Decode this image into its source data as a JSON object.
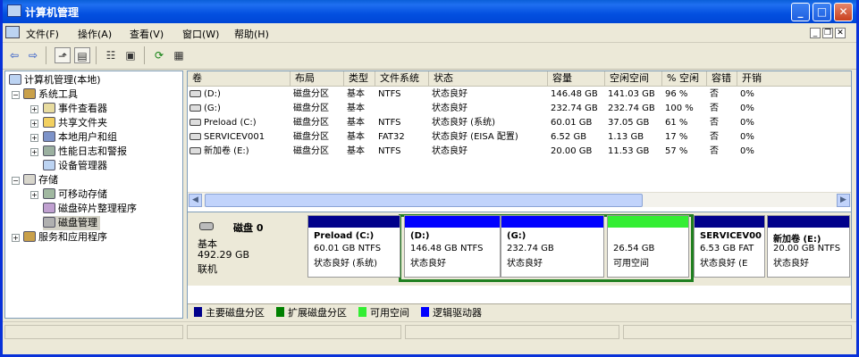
{
  "window": {
    "title": "计算机管理",
    "buttons": {
      "minimize": "_",
      "maximize": "□",
      "close": "✕"
    }
  },
  "menu": {
    "items": [
      "文件(F)",
      "操作(A)",
      "查看(V)",
      "窗口(W)",
      "帮助(H)"
    ],
    "mdi": [
      "_",
      "❐",
      "✕"
    ]
  },
  "toolbar": {
    "icons": [
      "back-arrow-icon",
      "forward-arrow-icon",
      "up-folder-icon",
      "show-hide-tree-icon",
      "properties-icon",
      "help-icon",
      "refresh-icon",
      "export-list-icon"
    ]
  },
  "tree": {
    "root": "计算机管理(本地)",
    "system_tools": "系统工具",
    "event_viewer": "事件查看器",
    "shared_folders": "共享文件夹",
    "local_users": "本地用户和组",
    "perf_logs": "性能日志和警报",
    "device_manager": "设备管理器",
    "storage": "存储",
    "removable": "可移动存储",
    "defrag": "磁盘碎片整理程序",
    "disk_mgmt": "磁盘管理",
    "services": "服务和应用程序"
  },
  "volumes": {
    "headers": [
      "卷",
      "布局",
      "类型",
      "文件系统",
      "状态",
      "容量",
      "空闲空间",
      "% 空闲",
      "容错",
      "开销"
    ],
    "rows": [
      [
        "(D:)",
        "磁盘分区",
        "基本",
        "NTFS",
        "状态良好",
        "146.48 GB",
        "141.03 GB",
        "96 %",
        "否",
        "0%"
      ],
      [
        "(G:)",
        "磁盘分区",
        "基本",
        "",
        "状态良好",
        "232.74 GB",
        "232.74 GB",
        "100 %",
        "否",
        "0%"
      ],
      [
        "Preload (C:)",
        "磁盘分区",
        "基本",
        "NTFS",
        "状态良好 (系统)",
        "60.01 GB",
        "37.05 GB",
        "61 %",
        "否",
        "0%"
      ],
      [
        "SERVICEV001",
        "磁盘分区",
        "基本",
        "FAT32",
        "状态良好 (EISA 配置)",
        "6.52 GB",
        "1.13 GB",
        "17 %",
        "否",
        "0%"
      ],
      [
        "新加卷 (E:)",
        "磁盘分区",
        "基本",
        "NTFS",
        "状态良好",
        "20.00 GB",
        "11.53 GB",
        "57 %",
        "否",
        "0%"
      ]
    ]
  },
  "disk": {
    "name": "磁盘 0",
    "type": "基本",
    "size": "492.29 GB",
    "status": "联机",
    "partitions": [
      {
        "name": "Preload  (C:)",
        "line1": "60.01 GB NTFS",
        "line2": "状态良好 (系统)",
        "color": "#00008b"
      },
      {
        "name": "(D:)",
        "line1": "146.48 GB NTFS",
        "line2": "状态良好",
        "color": "#0000ff"
      },
      {
        "name": "(G:)",
        "line1": "232.74 GB",
        "line2": "状态良好",
        "color": "#0000ff"
      },
      {
        "name": "",
        "line1": "26.54 GB",
        "line2": "可用空间",
        "color": "#33ee33"
      },
      {
        "name": "SERVICEV00",
        "line1": "6.53 GB FAT",
        "line2": "状态良好 (E",
        "color": "#00008b"
      },
      {
        "name": "新加卷  (E:)",
        "line1": "20.00 GB NTFS",
        "line2": "状态良好",
        "color": "#00008b"
      }
    ]
  },
  "legend": [
    {
      "label": "主要磁盘分区",
      "color": "#00008b"
    },
    {
      "label": "扩展磁盘分区",
      "color": "#008000"
    },
    {
      "label": "可用空间",
      "color": "#33ee33"
    },
    {
      "label": "逻辑驱动器",
      "color": "#0000ff"
    }
  ],
  "colors": {
    "title_blue": "#0350e0",
    "extended_border": "#208020"
  }
}
